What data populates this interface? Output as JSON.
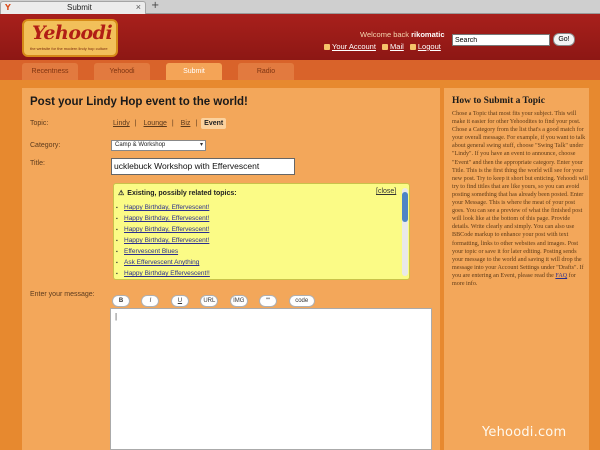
{
  "browser": {
    "tab_icon": "Y",
    "tab_title": "Submit",
    "tab_close": "×",
    "new_tab": "+"
  },
  "header": {
    "logo_text": "Yehoodi",
    "logo_tagline": "the website for the modern lindy hop culture",
    "welcome_prefix": "Welcome back",
    "username": "rikomatic",
    "links": {
      "account": "Your Account",
      "mail": "Mail",
      "logout": "Logout"
    },
    "search_value": "Search",
    "go_label": "Go!"
  },
  "nav": {
    "tabs": [
      "Recentness",
      "Yehoodi",
      "Submit",
      "Radio"
    ]
  },
  "form": {
    "page_title": "Post your Lindy Hop event to the world!",
    "topic_label": "Topic:",
    "topics": [
      "Lindy",
      "Lounge",
      "Biz",
      "Event"
    ],
    "active_topic": "Event",
    "category_label": "Category:",
    "category_value": "Camp & Workshop",
    "title_label": "Title:",
    "title_value": "ucklebuck Workshop with Effervescent",
    "related_heading": "Existing, possibly related topics:",
    "related_close": "[close]",
    "related_topics": [
      "Happy Birthday, Effervescent!",
      "Happy Birthday, Effervescent!",
      "Happy Birthday, Effervescent!",
      "Happy Birthday, Effervescent!",
      "Effervescent Blues",
      "Ask Effervescent Anything",
      "Happy Birthday Effervescent!!"
    ],
    "message_label": "Enter your message:",
    "format_buttons": [
      "B",
      "I",
      "U",
      "URL",
      "IMG",
      "““",
      "code"
    ],
    "message_value": "|"
  },
  "sidebar": {
    "title": "How to Submit a Topic",
    "body": "Chose a Topic that most fits your subject. This will make it easier for other Yehoodites to find your post. Chose a Category from the list that's a good match for your overall message. For example, if you want to talk about general swing stuff, choose \"Swing Talk\" under \"Lindy\". If you have an event to announce, choose \"Event\" and then the appropriate category. Enter your Title. This is the first thing the world will see for your new post. Try to keep it short but enticing. Yehoodi will try to find titles that are like yours, so you can avoid posting something that has already been posted. Enter your Message. This is where the meat of your post goes. You can see a preview of what the finished post will look like at the bottom of this page. Provide details. Write clearly and simply. You can also use BBCode markup to enhance your post with text formatting, links to other websites and images. Post your topic or save it for later editing. Posting sends your message to the world and saving it will drop the message into your Account Settings under \"Drafts\". If you are entering an Event, please read the",
    "faq_link": "FAQ",
    "tail": "for more info."
  },
  "watermark": "Yehoodi.com",
  "colors": {
    "header": "#a8201c",
    "nav": "#d9632a",
    "panel": "#f3a75a",
    "related_box": "#fbfb86",
    "background": "#e7892f"
  },
  "icons": {
    "warning": "warning-icon",
    "account": "account-icon",
    "mail": "mail-icon",
    "logout": "logout-icon"
  }
}
